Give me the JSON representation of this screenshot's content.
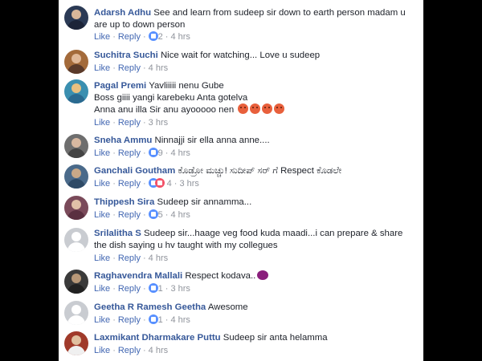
{
  "comments": [
    {
      "name": "Adarsh Adhu",
      "text": "See and learn from sudeep sir down to earth person madam u are up to down person",
      "like": "Like",
      "reply": "Reply",
      "reactions": "2",
      "time": "4 hrs",
      "avatar_color": "#2b3a55"
    },
    {
      "name": "Suchitra Suchi",
      "text": "Nice wait for watching... Love u sudeep",
      "like": "Like",
      "reply": "Reply",
      "reactions": "",
      "time": "4 hrs",
      "avatar_color": "#a36a3a"
    },
    {
      "name": "Pagal Premi",
      "lines": [
        "Yavliiiii nenu Gube",
        "Boss giiii yangi karebeku Anta gotelva",
        "Anna anu illa Sir anu ayooooo nen"
      ],
      "like": "Like",
      "reply": "Reply",
      "reactions": "",
      "time": "3 hrs",
      "avatar_color": "#3a8fb0"
    },
    {
      "name": "Sneha Ammu",
      "text": "Ninnajji sir ella anna anne....",
      "like": "Like",
      "reply": "Reply",
      "reactions": "9",
      "time": "4 hrs",
      "avatar_color": "#6e6e6e"
    },
    {
      "name": "Ganchali Goutham",
      "text": "ಕೊಡ್ರೋ ಮಚ್ಚು! ಸುದೀಪ್ ಸರ್ ಗೆ Respect ಕೊಡಲೇ",
      "like": "Like",
      "reply": "Reply",
      "reactions": "4",
      "time": "3 hrs",
      "avatar_color": "#4a6a8a"
    },
    {
      "name": "Thippesh Sira",
      "text": "Sudeep sir annamma...",
      "like": "Like",
      "reply": "Reply",
      "reactions": "5",
      "time": "4 hrs",
      "avatar_color": "#7a4a5a"
    },
    {
      "name": "Srilalitha S",
      "text": "Sudeep sir...haage veg food kuda maadi...i can prepare & share the dish saying u hv taught with my collegues",
      "like": "Like",
      "reply": "Reply",
      "reactions": "",
      "time": "4 hrs",
      "avatar_color": "#c9ccd1"
    },
    {
      "name": "Raghavendra Mallali",
      "text": "Respect kodava..",
      "like": "Like",
      "reply": "Reply",
      "reactions": "1",
      "time": "3 hrs",
      "avatar_color": "#3a3a3a"
    },
    {
      "name": "Geetha R Ramesh Geetha",
      "text": "Awesome",
      "like": "Like",
      "reply": "Reply",
      "reactions": "1",
      "time": "4 hrs",
      "avatar_color": "#c9ccd1"
    },
    {
      "name": "Laxmikant Dharmakare Puttu",
      "text": "Sudeep sir anta helamma",
      "like": "Like",
      "reply": "Reply",
      "reactions": "",
      "time": "4 hrs",
      "avatar_color": "#a03a2a"
    }
  ]
}
